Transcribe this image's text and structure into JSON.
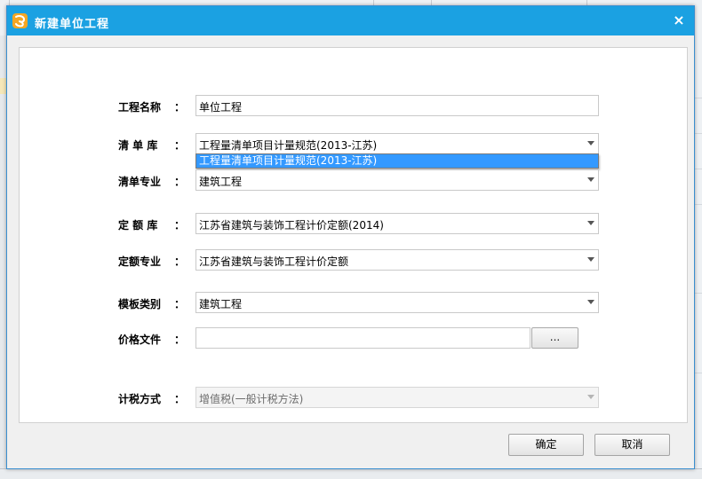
{
  "dialog": {
    "title": "新建单位工程",
    "close_glyph": "×"
  },
  "form": {
    "project_name": {
      "label": "工程名称",
      "colon": "：",
      "value": "单位工程"
    },
    "bill_library": {
      "label": "清 单 库",
      "colon": "：",
      "value": "工程量清单项目计量规范(2013-江苏)",
      "dropdown_open": true,
      "options": [
        "工程量清单项目计量规范(2013-江苏)"
      ]
    },
    "bill_specialty": {
      "label": "清单专业",
      "colon": "：",
      "value": "建筑工程"
    },
    "quota_library": {
      "label": "定 额 库",
      "colon": "：",
      "value": "江苏省建筑与装饰工程计价定额(2014)"
    },
    "quota_specialty": {
      "label": "定额专业",
      "colon": "：",
      "value": "江苏省建筑与装饰工程计价定额"
    },
    "template_type": {
      "label": "模板类别",
      "colon": "：",
      "value": "建筑工程"
    },
    "price_file": {
      "label": "价格文件",
      "colon": "：",
      "value": "",
      "browse_label": "..."
    },
    "tax_method": {
      "label": "计税方式",
      "colon": "：",
      "value": "增值税(一般计税方法)",
      "disabled": true
    }
  },
  "buttons": {
    "ok": "确定",
    "cancel": "取消"
  },
  "icons": {
    "app": "software-logo-icon",
    "close": "close-icon",
    "dropdown": "chevron-down-icon"
  },
  "colors": {
    "titlebar": "#1ba1e2",
    "selection": "#3399ff",
    "app_icon": "#f5a623"
  }
}
